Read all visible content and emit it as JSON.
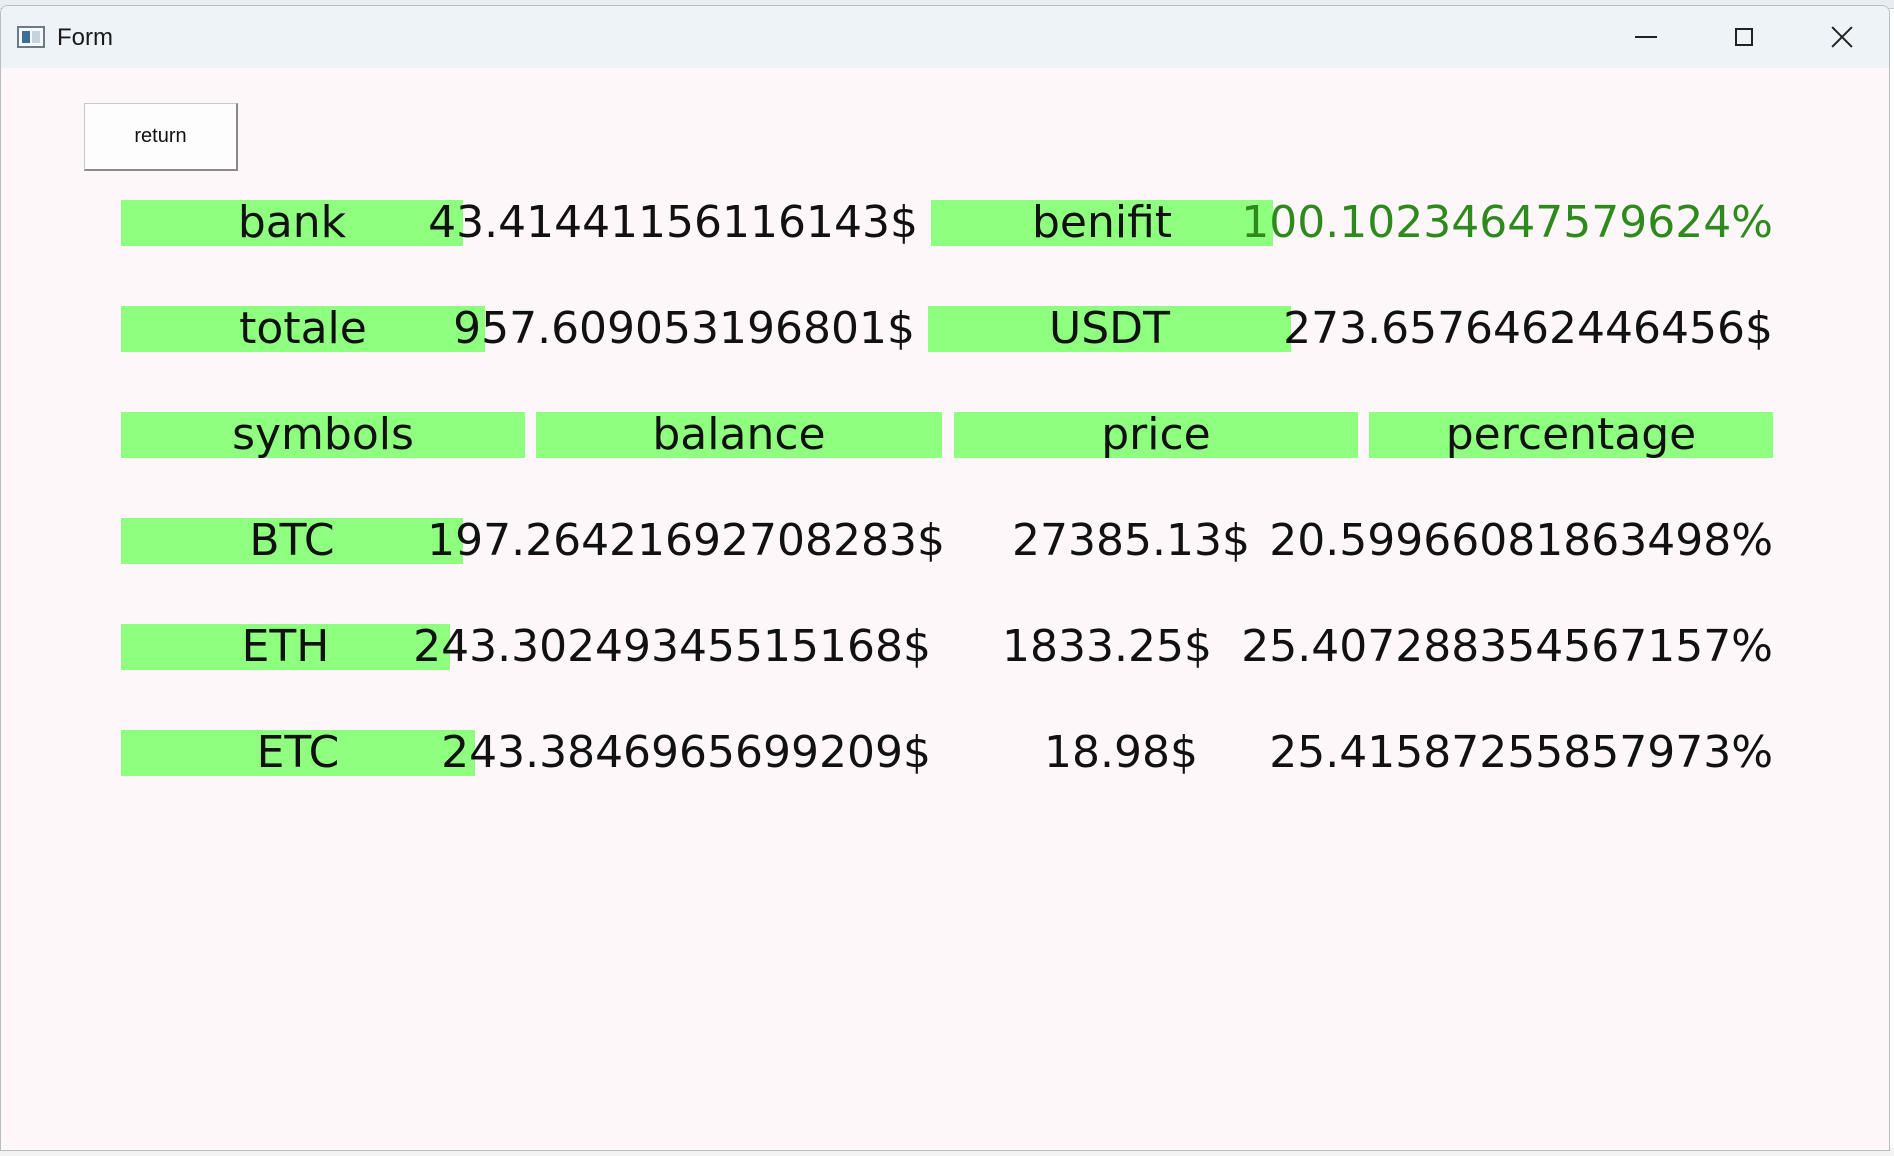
{
  "window": {
    "title": "Form",
    "controls": {
      "minimize_icon": "minimize-icon",
      "maximize_icon": "maximize-icon",
      "close_icon": "close-icon"
    }
  },
  "return_button": "return",
  "summary": {
    "bank": {
      "label": "bank",
      "value": "43.41441156116143$"
    },
    "benifit": {
      "label": "benifit",
      "value": "100.10234647579624%",
      "color": "#2f8a1e"
    },
    "totale": {
      "label": "totale",
      "value": "957.609053196801$"
    },
    "usdt": {
      "label": "USDT",
      "value": "273.6576462446456$"
    }
  },
  "table": {
    "headers": [
      "symbols",
      "balance",
      "price",
      "percentage"
    ],
    "rows": [
      {
        "symbol": "BTC",
        "balance": "197.26421692708283$",
        "price": "27385.13$",
        "percentage": "20.59966081863498%"
      },
      {
        "symbol": "ETH",
        "balance": "243.30249345515168$",
        "price": "1833.25$",
        "percentage": "25.407288354567157%"
      },
      {
        "symbol": "ETC",
        "balance": "243.3846965699209$",
        "price": "18.98$",
        "percentage": "25.41587255857973%"
      }
    ]
  },
  "colors": {
    "label_bg": "#8eff7e",
    "window_bg": "#fdf7f9"
  }
}
